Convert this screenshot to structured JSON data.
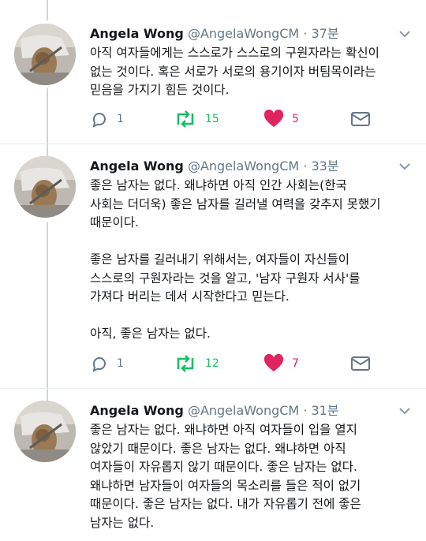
{
  "colors": {
    "retweet": "#17bf63",
    "like": "#e0245e",
    "muted": "#657786",
    "thread": "#ccd6dd"
  },
  "icons": [
    "reply-icon",
    "retweet-icon",
    "like-icon",
    "message-icon",
    "chevron-down-icon"
  ],
  "tweets": [
    {
      "name": "Angela Wong",
      "handle": "@AngelaWongCM",
      "time": "· 37분",
      "text": "아직 여자들에게는 스스로가 스스로의 구원자라는 확신이\n없는 것이다. 혹은 서로가 서로의 용기이자 버팀목이라는\n믿음을 가지기 힘든 것이다.",
      "replies": "1",
      "retweets": "15",
      "likes": "5"
    },
    {
      "name": "Angela Wong",
      "handle": "@AngelaWongCM",
      "time": "· 33분",
      "text": "좋은 남자는 없다. 왜냐하면 아직 인간 사회는(한국\n사회는 더더욱) 좋은 남자를 길러낼 여력을 갖추지 못했기\n때문이다.\n\n좋은 남자를 길러내기 위해서는, 여자들이 자신들이\n스스로의 구원자라는 것을 알고, '남자 구원자 서사'를\n가져다 버리는 데서 시작한다고 믿는다.\n\n아직, 좋은 남자는 없다.",
      "replies": "1",
      "retweets": "12",
      "likes": "7"
    },
    {
      "name": "Angela Wong",
      "handle": "@AngelaWongCM",
      "time": "· 31분",
      "text": "좋은 남자는 없다. 왜냐하면 아직 여자들이 입을 열지\n않았기 때문이다. 좋은 남자는 없다. 왜냐하면 아직\n여자들이 자유롭지 않기 때문이다. 좋은 남자는 없다.\n왜냐하면 남자들이 여자들의 목소리를 들은 적이 없기\n때문이다. 좋은 남자는 없다. 내가 자유롭기 전에 좋은\n남자는 없다."
    }
  ]
}
